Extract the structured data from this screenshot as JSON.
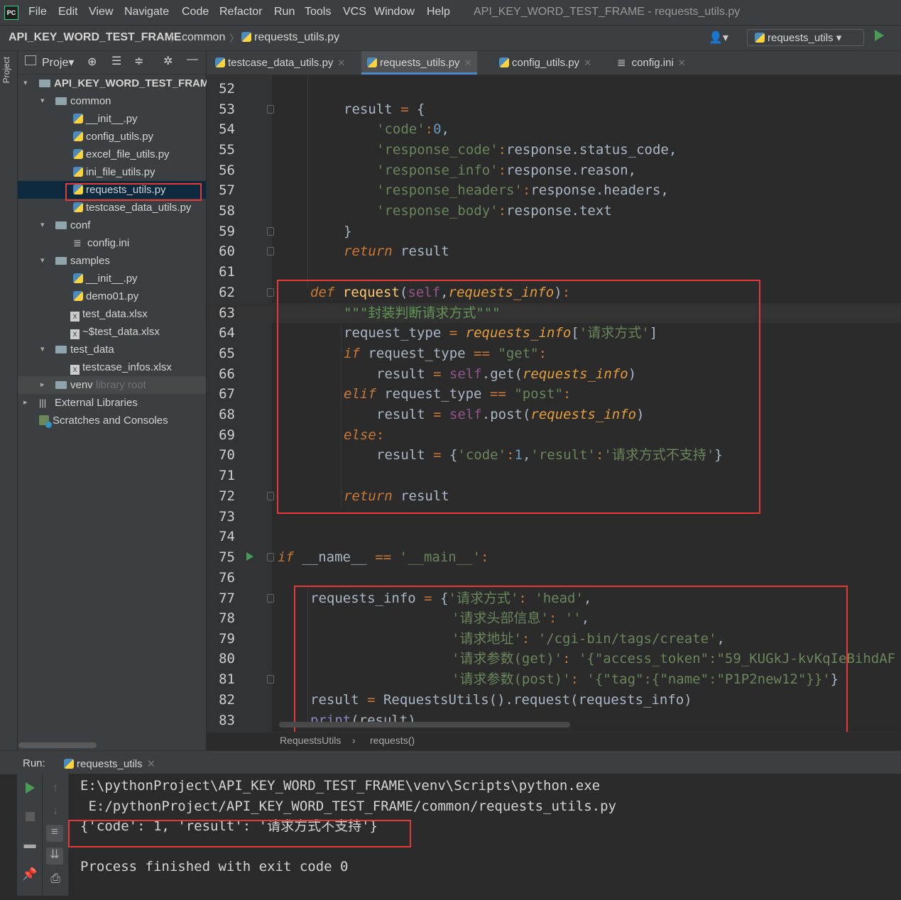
{
  "app": {
    "menu": [
      "File",
      "Edit",
      "View",
      "Navigate",
      "Code",
      "Refactor",
      "Run",
      "Tools",
      "VCS",
      "Window",
      "Help"
    ],
    "window_title": "API_KEY_WORD_TEST_FRAME - requests_utils.py",
    "logo": "PC"
  },
  "navbar": {
    "project": "API_KEY_WORD_TEST_FRAME",
    "folder": "common",
    "file": "requests_utils.py",
    "run_config": "requests_utils"
  },
  "sidebar": {
    "stripe_label": "Project",
    "toolbar_label": "Proje",
    "tree": [
      {
        "label": "API_KEY_WORD_TEST_FRAM",
        "kind": "root"
      },
      {
        "label": "common",
        "kind": "folder"
      },
      {
        "label": "__init__.py",
        "kind": "py"
      },
      {
        "label": "config_utils.py",
        "kind": "py"
      },
      {
        "label": "excel_file_utils.py",
        "kind": "py"
      },
      {
        "label": "ini_file_utils.py",
        "kind": "py"
      },
      {
        "label": "requests_utils.py",
        "kind": "py",
        "selected": true
      },
      {
        "label": "testcase_data_utils.py",
        "kind": "py"
      },
      {
        "label": "conf",
        "kind": "folder"
      },
      {
        "label": "config.ini",
        "kind": "ini"
      },
      {
        "label": "samples",
        "kind": "folder"
      },
      {
        "label": "__init__.py",
        "kind": "py"
      },
      {
        "label": "demo01.py",
        "kind": "py"
      },
      {
        "label": "test_data.xlsx",
        "kind": "xlsx"
      },
      {
        "label": "~$test_data.xlsx",
        "kind": "xlsx"
      },
      {
        "label": "test_data",
        "kind": "folder"
      },
      {
        "label": "testcase_infos.xlsx",
        "kind": "xlsx"
      },
      {
        "label": "venv",
        "kind": "folder",
        "suffix": "library root"
      },
      {
        "label": "External Libraries",
        "kind": "lib"
      },
      {
        "label": "Scratches and Consoles",
        "kind": "scratch"
      }
    ]
  },
  "tabs": [
    {
      "label": "testcase_data_utils.py",
      "active": false
    },
    {
      "label": "requests_utils.py",
      "active": true
    },
    {
      "label": "config_utils.py",
      "active": false
    },
    {
      "label": "config.ini",
      "active": false
    }
  ],
  "editor": {
    "line_numbers": [
      "52",
      "53",
      "54",
      "55",
      "56",
      "57",
      "58",
      "59",
      "60",
      "61",
      "62",
      "63",
      "64",
      "65",
      "66",
      "67",
      "68",
      "69",
      "70",
      "71",
      "72",
      "73",
      "74",
      "75",
      "76",
      "77",
      "78",
      "79",
      "80",
      "81",
      "82",
      "83"
    ],
    "breadcrumb": [
      "RequestsUtils",
      "requests()"
    ]
  },
  "run": {
    "label": "Run:",
    "tab": "requests_utils",
    "output": [
      "E:\\pythonProject\\API_KEY_WORD_TEST_FRAME\\venv\\Scripts\\python.exe",
      " E:/pythonProject/API_KEY_WORD_TEST_FRAME/common/requests_utils.py",
      "{'code': 1, 'result': '请求方式不支持'}",
      "",
      "Process finished with exit code 0"
    ]
  },
  "colors": {
    "accent": "#4a88c7",
    "highlight_box": "#e53935",
    "run_green": "#499c54"
  }
}
